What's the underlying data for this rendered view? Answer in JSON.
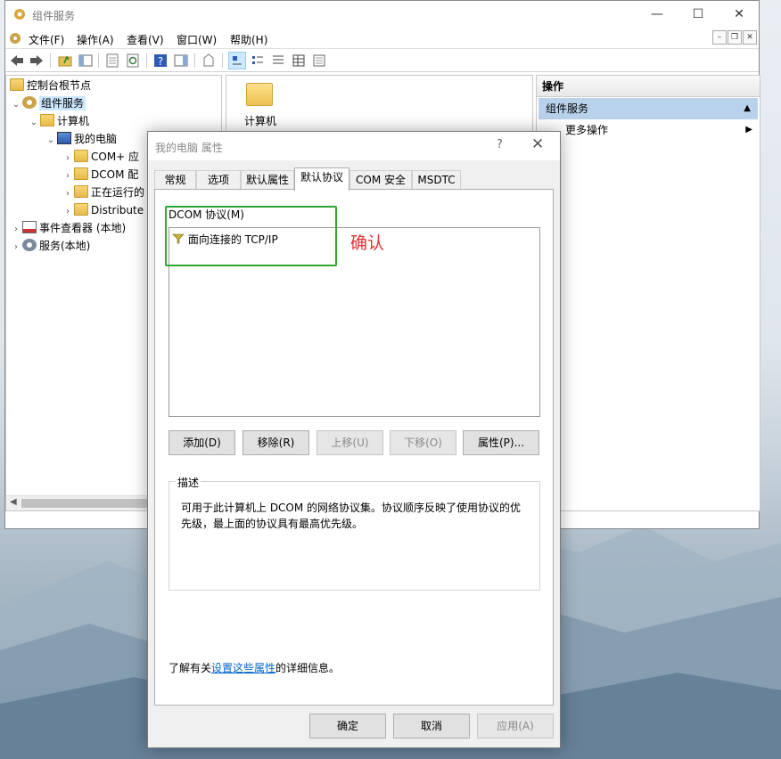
{
  "main_window": {
    "title": "组件服务",
    "menu": [
      "文件(F)",
      "操作(A)",
      "查看(V)",
      "窗口(W)",
      "帮助(H)"
    ],
    "tree": [
      {
        "label": "控制台根节点",
        "name": "tree-item-console-root"
      },
      {
        "label": "组件服务",
        "name": "tree-item-component-services",
        "selected": true
      },
      {
        "label": "计算机",
        "name": "tree-item-computers"
      },
      {
        "label": "我的电脑",
        "name": "tree-item-my-computer"
      },
      {
        "label": "COM+ 应",
        "name": "tree-item-com-plus"
      },
      {
        "label": "DCOM 配",
        "name": "tree-item-dcom-config"
      },
      {
        "label": "正在运行的",
        "name": "tree-item-running"
      },
      {
        "label": "Distribute",
        "name": "tree-item-distributed"
      },
      {
        "label": "事件查看器 (本地)",
        "name": "tree-item-event-viewer"
      },
      {
        "label": "服务(本地)",
        "name": "tree-item-services"
      }
    ],
    "content_item": "计算机",
    "actions": {
      "header": "操作",
      "section": "组件服务",
      "item": "更多操作"
    }
  },
  "dialog": {
    "title": "我的电脑 属性",
    "help": "?",
    "tabs": [
      "常规",
      "选项",
      "默认属性",
      "默认协议",
      "COM 安全",
      "MSDTC"
    ],
    "active_tab": "默认协议",
    "group_label": "DCOM 协议(M)",
    "protocols": [
      "面向连接的 TCP/IP"
    ],
    "annotation": "确认",
    "buttons": {
      "add": "添加(D)",
      "remove": "移除(R)",
      "move_up": "上移(U)",
      "move_down": "下移(O)",
      "properties": "属性(P)..."
    },
    "description": {
      "title": "描述",
      "text": "可用于此计算机上 DCOM 的网络协议集。协议顺序反映了使用协议的优先级，最上面的协议具有最高优先级。"
    },
    "info": {
      "prefix": "了解有关",
      "link": "设置这些属性",
      "suffix": "的详细信息。"
    },
    "footer": {
      "ok": "确定",
      "cancel": "取消",
      "apply": "应用(A)"
    }
  },
  "colors": {
    "highlight_box": "#2ea632",
    "annotation": "#e03131",
    "selection": "#cce8ff",
    "link": "#0066cc"
  }
}
